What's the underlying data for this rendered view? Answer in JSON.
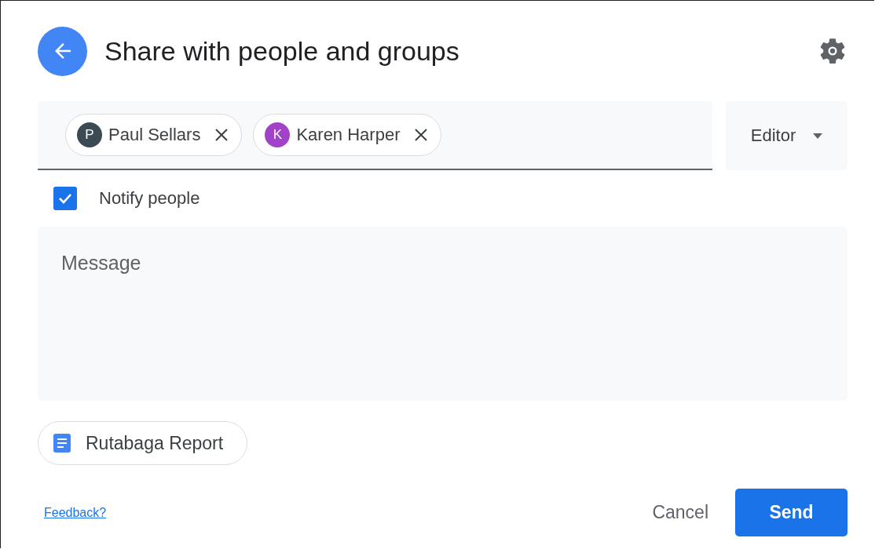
{
  "header": {
    "title": "Share with people and groups"
  },
  "recipients": [
    {
      "initial": "P",
      "name": "Paul Sellars",
      "color": "#3c4a54"
    },
    {
      "initial": "K",
      "name": "Karen Harper",
      "color": "#a142c8"
    }
  ],
  "role": {
    "value": "Editor"
  },
  "notify": {
    "label": "Notify people",
    "checked": true
  },
  "message": {
    "placeholder": "Message"
  },
  "attachment": {
    "name": "Rutabaga Report"
  },
  "footer": {
    "feedback": "Feedback?",
    "buttons": [
      {
        "label": "Cancel",
        "kind": "text"
      },
      {
        "label": "Send",
        "kind": "primary"
      }
    ]
  }
}
